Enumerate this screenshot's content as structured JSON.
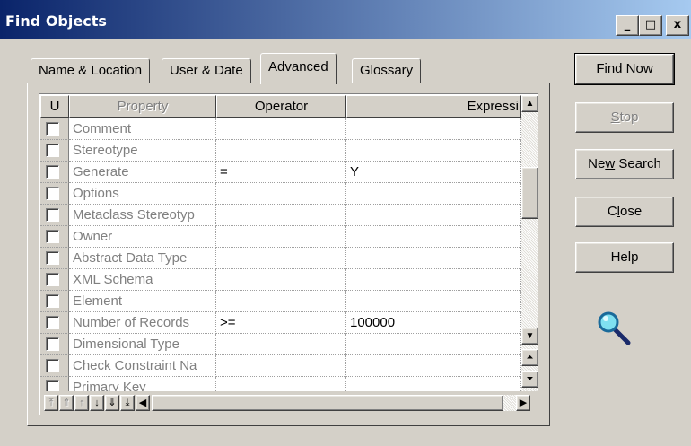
{
  "window": {
    "title": "Find Objects",
    "minimize_glyph": "_",
    "maximize_glyph": "□",
    "close_glyph": "x"
  },
  "tabs": [
    {
      "label": "Name & Location",
      "active": false
    },
    {
      "label": "User & Date",
      "active": false
    },
    {
      "label": "Advanced",
      "active": true
    },
    {
      "label": "Glossary",
      "active": false
    }
  ],
  "grid": {
    "headers": {
      "u": "U",
      "property": "Property",
      "operator": "Operator",
      "expression": "Expressi"
    },
    "rows": [
      {
        "property": "Comment",
        "operator": "",
        "expression": "",
        "checked": false
      },
      {
        "property": "Stereotype",
        "operator": "",
        "expression": "",
        "checked": false
      },
      {
        "property": "Generate",
        "operator": "=",
        "expression": "Y",
        "checked": false
      },
      {
        "property": "Options",
        "operator": "",
        "expression": "",
        "checked": false
      },
      {
        "property": "Metaclass Stereotyp",
        "operator": "",
        "expression": "",
        "checked": false
      },
      {
        "property": "Owner",
        "operator": "",
        "expression": "",
        "checked": false
      },
      {
        "property": "Abstract Data Type",
        "operator": "",
        "expression": "",
        "checked": false
      },
      {
        "property": "XML Schema",
        "operator": "",
        "expression": "",
        "checked": false
      },
      {
        "property": "Element",
        "operator": "",
        "expression": "",
        "checked": false
      },
      {
        "property": "Number of Records",
        "operator": ">=",
        "expression": "100000",
        "checked": false
      },
      {
        "property": "Dimensional Type",
        "operator": "",
        "expression": "",
        "checked": false
      },
      {
        "property": "Check Constraint Na",
        "operator": "",
        "expression": "",
        "checked": false
      },
      {
        "property": "Primary Key",
        "operator": "",
        "expression": "",
        "checked": false
      }
    ]
  },
  "buttons": {
    "find_now": {
      "pre": "",
      "u": "F",
      "post": "ind Now"
    },
    "stop": {
      "pre": "",
      "u": "S",
      "post": "top"
    },
    "new_search": {
      "pre": "Ne",
      "u": "w",
      "post": " Search"
    },
    "close": {
      "pre": "C",
      "u": "l",
      "post": "ose"
    },
    "help": {
      "pre": "Help",
      "u": "",
      "post": ""
    }
  },
  "icons": {
    "search": "magnifier-icon"
  }
}
